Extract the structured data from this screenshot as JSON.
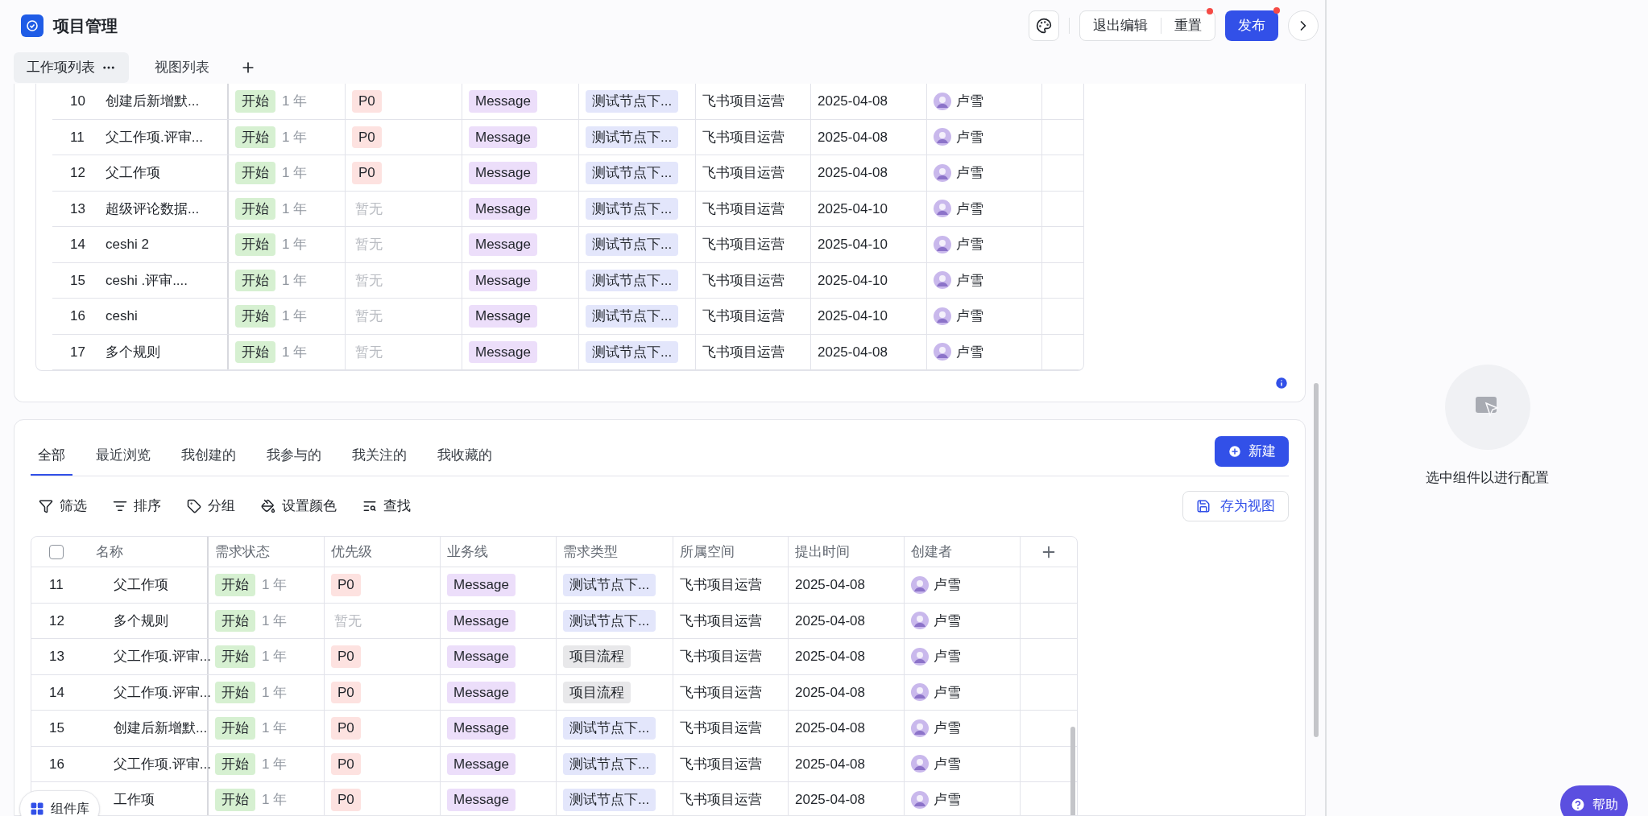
{
  "header": {
    "title": "项目管理",
    "page_tabs": [
      {
        "label": "工作项列表",
        "selected": true
      },
      {
        "label": "视图列表",
        "selected": false
      }
    ],
    "exit_edit": "退出编辑",
    "reset": "重置",
    "reset_dot": true,
    "publish": "发布",
    "publish_dot": true
  },
  "top_table": {
    "rows": [
      {
        "num": "10",
        "name": "创建后新增默...",
        "status": "开始",
        "duration": "1 年",
        "priority": {
          "kind": "tag",
          "text": "P0"
        },
        "business": "Message",
        "type": {
          "kind": "node",
          "text": "测试节点下..."
        },
        "space": "飞书项目运营",
        "date": "2025-04-08",
        "creator": "卢雪"
      },
      {
        "num": "11",
        "name": "父工作项.评审...",
        "status": "开始",
        "duration": "1 年",
        "priority": {
          "kind": "tag",
          "text": "P0"
        },
        "business": "Message",
        "type": {
          "kind": "node",
          "text": "测试节点下..."
        },
        "space": "飞书项目运营",
        "date": "2025-04-08",
        "creator": "卢雪"
      },
      {
        "num": "12",
        "name": "父工作项",
        "status": "开始",
        "duration": "1 年",
        "priority": {
          "kind": "tag",
          "text": "P0"
        },
        "business": "Message",
        "type": {
          "kind": "node",
          "text": "测试节点下..."
        },
        "space": "飞书项目运营",
        "date": "2025-04-08",
        "creator": "卢雪"
      },
      {
        "num": "13",
        "name": "超级评论数据...",
        "status": "开始",
        "duration": "1 年",
        "priority": {
          "kind": "empty",
          "text": "暂无"
        },
        "business": "Message",
        "type": {
          "kind": "node",
          "text": "测试节点下..."
        },
        "space": "飞书项目运营",
        "date": "2025-04-10",
        "creator": "卢雪"
      },
      {
        "num": "14",
        "name": "ceshi 2",
        "status": "开始",
        "duration": "1 年",
        "priority": {
          "kind": "empty",
          "text": "暂无"
        },
        "business": "Message",
        "type": {
          "kind": "node",
          "text": "测试节点下..."
        },
        "space": "飞书项目运营",
        "date": "2025-04-10",
        "creator": "卢雪"
      },
      {
        "num": "15",
        "name": "ceshi .评审....",
        "status": "开始",
        "duration": "1 年",
        "priority": {
          "kind": "empty",
          "text": "暂无"
        },
        "business": "Message",
        "type": {
          "kind": "node",
          "text": "测试节点下..."
        },
        "space": "飞书项目运营",
        "date": "2025-04-10",
        "creator": "卢雪"
      },
      {
        "num": "16",
        "name": "ceshi",
        "status": "开始",
        "duration": "1 年",
        "priority": {
          "kind": "empty",
          "text": "暂无"
        },
        "business": "Message",
        "type": {
          "kind": "node",
          "text": "测试节点下..."
        },
        "space": "飞书项目运营",
        "date": "2025-04-10",
        "creator": "卢雪"
      },
      {
        "num": "17",
        "name": "多个规则",
        "status": "开始",
        "duration": "1 年",
        "priority": {
          "kind": "empty",
          "text": "暂无"
        },
        "business": "Message",
        "type": {
          "kind": "node",
          "text": "测试节点下..."
        },
        "space": "飞书项目运营",
        "date": "2025-04-08",
        "creator": "卢雪"
      }
    ]
  },
  "list": {
    "filters": [
      {
        "label": "全部",
        "selected": true
      },
      {
        "label": "最近浏览",
        "selected": false
      },
      {
        "label": "我创建的",
        "selected": false
      },
      {
        "label": "我参与的",
        "selected": false
      },
      {
        "label": "我关注的",
        "selected": false
      },
      {
        "label": "我收藏的",
        "selected": false
      }
    ],
    "new_button": "新建",
    "tools": [
      {
        "kind": "filter",
        "label": "筛选"
      },
      {
        "kind": "sort",
        "label": "排序"
      },
      {
        "kind": "group",
        "label": "分组"
      },
      {
        "kind": "color",
        "label": "设置颜色"
      },
      {
        "kind": "find",
        "label": "查找"
      }
    ],
    "save_view": "存为视图",
    "select_all": {
      "checked": false
    },
    "columns": [
      "名称",
      "需求状态",
      "优先级",
      "业务线",
      "需求类型",
      "所属空间",
      "提出时间",
      "创建者"
    ],
    "rows": [
      {
        "num": "11",
        "name": "父工作项",
        "status": "开始",
        "duration": "1 年",
        "priority": {
          "kind": "tag",
          "text": "P0"
        },
        "business": "Message",
        "type": {
          "kind": "node",
          "text": "测试节点下..."
        },
        "space": "飞书项目运营",
        "date": "2025-04-08",
        "creator": "卢雪"
      },
      {
        "num": "12",
        "name": "多个规则",
        "status": "开始",
        "duration": "1 年",
        "priority": {
          "kind": "empty",
          "text": "暂无"
        },
        "business": "Message",
        "type": {
          "kind": "node",
          "text": "测试节点下..."
        },
        "space": "飞书项目运营",
        "date": "2025-04-08",
        "creator": "卢雪"
      },
      {
        "num": "13",
        "name": "父工作项.评审...",
        "status": "开始",
        "duration": "1 年",
        "priority": {
          "kind": "tag",
          "text": "P0"
        },
        "business": "Message",
        "type": {
          "kind": "flow",
          "text": "项目流程"
        },
        "space": "飞书项目运营",
        "date": "2025-04-08",
        "creator": "卢雪"
      },
      {
        "num": "14",
        "name": "父工作项.评审...",
        "status": "开始",
        "duration": "1 年",
        "priority": {
          "kind": "tag",
          "text": "P0"
        },
        "business": "Message",
        "type": {
          "kind": "flow",
          "text": "项目流程"
        },
        "space": "飞书项目运营",
        "date": "2025-04-08",
        "creator": "卢雪"
      },
      {
        "num": "15",
        "name": "创建后新增默...",
        "status": "开始",
        "duration": "1 年",
        "priority": {
          "kind": "tag",
          "text": "P0"
        },
        "business": "Message",
        "type": {
          "kind": "node",
          "text": "测试节点下..."
        },
        "space": "飞书项目运营",
        "date": "2025-04-08",
        "creator": "卢雪"
      },
      {
        "num": "16",
        "name": "父工作项.评审...",
        "status": "开始",
        "duration": "1 年",
        "priority": {
          "kind": "tag",
          "text": "P0"
        },
        "business": "Message",
        "type": {
          "kind": "node",
          "text": "测试节点下..."
        },
        "space": "飞书项目运营",
        "date": "2025-04-08",
        "creator": "卢雪"
      },
      {
        "name": "工作项",
        "status": "开始",
        "duration": "1 年",
        "priority": {
          "kind": "tag",
          "text": "P0"
        },
        "business": "Message",
        "type": {
          "kind": "node",
          "text": "测试节点下..."
        },
        "space": "飞书项目运营",
        "date": "2025-04-08",
        "creator": "卢雪"
      }
    ]
  },
  "library_button": "组件库",
  "side_panel": {
    "hint": "选中组件以进行配置",
    "help": "帮助"
  }
}
